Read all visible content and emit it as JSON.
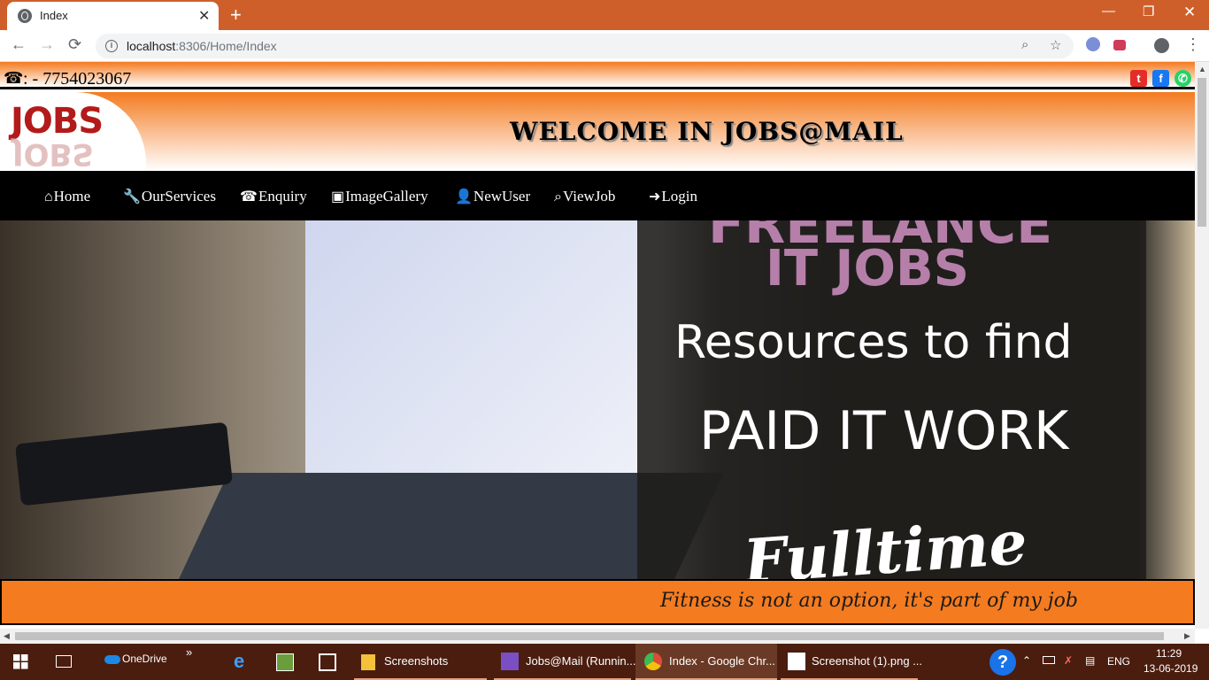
{
  "browser": {
    "tab_title": "Index",
    "close_glyph": "✕",
    "new_tab_glyph": "+",
    "window_controls": {
      "minimize": "—",
      "maximize": "❐",
      "close": "✕"
    },
    "url_host": "localhost",
    "url_rest": ":8306/Home/Index",
    "back_glyph": "←",
    "forward_glyph": "→",
    "reload_glyph": "⟳",
    "zoom_glyph": "⌕",
    "star_glyph": "☆",
    "menu_glyph": "⋮"
  },
  "page": {
    "phone_label": ": - 7754023067",
    "phone_icon": "☎",
    "social": [
      {
        "name": "twitter",
        "glyph": "t",
        "color": "#e52d27"
      },
      {
        "name": "facebook",
        "glyph": "f",
        "color": "#1877f2"
      },
      {
        "name": "whatsapp",
        "glyph": "✆",
        "color": "#25d366"
      }
    ],
    "logo_text": "JOBS",
    "welcome": "WELCOME  IN  JOBS@MAIL",
    "nav": [
      {
        "label": "Home",
        "icon": "⌂"
      },
      {
        "label": "OurServices",
        "icon": "🔧"
      },
      {
        "label": "Enquiry",
        "icon": "☎"
      },
      {
        "label": "ImageGallery",
        "icon": "▣"
      },
      {
        "label": "NewUser",
        "icon": "👤"
      },
      {
        "label": "ViewJob",
        "icon": "⌕"
      },
      {
        "label": "Login",
        "icon": "➜"
      }
    ],
    "hero": {
      "top_text": "FREELANCE",
      "it_jobs": "IT JOBS",
      "resources": "Resources to find",
      "paid": "PAID IT WORK",
      "fulltime": "Fulltime"
    },
    "marquee": "Fitness is not an option, it's part of my job"
  },
  "taskbar": {
    "onedrive": "OneDrive",
    "more": "»",
    "items": [
      {
        "label": "Screenshots",
        "color": "#f3c13a"
      },
      {
        "label": "Jobs@Mail (Runnin...",
        "color": "#7b4fc4"
      },
      {
        "label": "Index - Google Chr...",
        "color": "#dd4b39",
        "active": true
      },
      {
        "label": "Screenshot (1).png ...",
        "color": "#ffffff"
      }
    ],
    "lang": "ENG",
    "time": "11:29",
    "date": "13-06-2019",
    "help": "?"
  }
}
